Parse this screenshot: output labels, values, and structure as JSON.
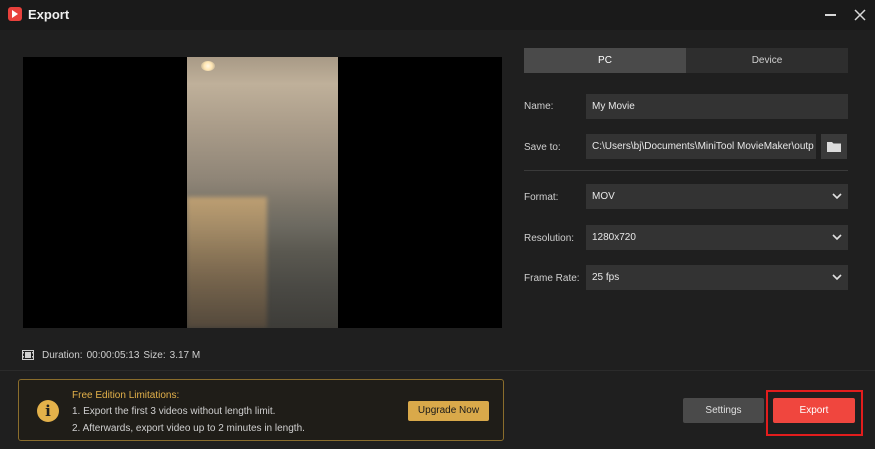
{
  "window": {
    "title": "Export"
  },
  "preview": {
    "duration_label": "Duration:",
    "duration_value": "00:00:05:13",
    "size_label": "Size:",
    "size_value": "3.17 M"
  },
  "tabs": [
    {
      "label": "PC",
      "active": true
    },
    {
      "label": "Device",
      "active": false
    }
  ],
  "form": {
    "name_label": "Name:",
    "name_value": "My Movie",
    "save_label": "Save to:",
    "save_value": "C:\\Users\\bj\\Documents\\MiniTool MovieMaker\\outp",
    "format_label": "Format:",
    "format_value": "MOV",
    "resolution_label": "Resolution:",
    "resolution_value": "1280x720",
    "framerate_label": "Frame Rate:",
    "framerate_value": "25 fps"
  },
  "limitations": {
    "title": "Free Edition Limitations:",
    "line1": "1. Export the first 3 videos without length limit.",
    "line2": "2. Afterwards, export video up to 2 minutes in length.",
    "upgrade_label": "Upgrade Now"
  },
  "actions": {
    "settings_label": "Settings",
    "export_label": "Export"
  },
  "colors": {
    "accent_red": "#f0463e",
    "highlight_outline": "#e31d1d",
    "gold": "#e3b14a",
    "background": "#1f1f1f"
  },
  "icons": {
    "app": "minitool-logo-icon",
    "minimize": "minimize-icon",
    "close": "close-icon",
    "film": "film-icon",
    "folder": "folder-icon",
    "chevron": "chevron-down-icon",
    "info": "info-icon"
  }
}
